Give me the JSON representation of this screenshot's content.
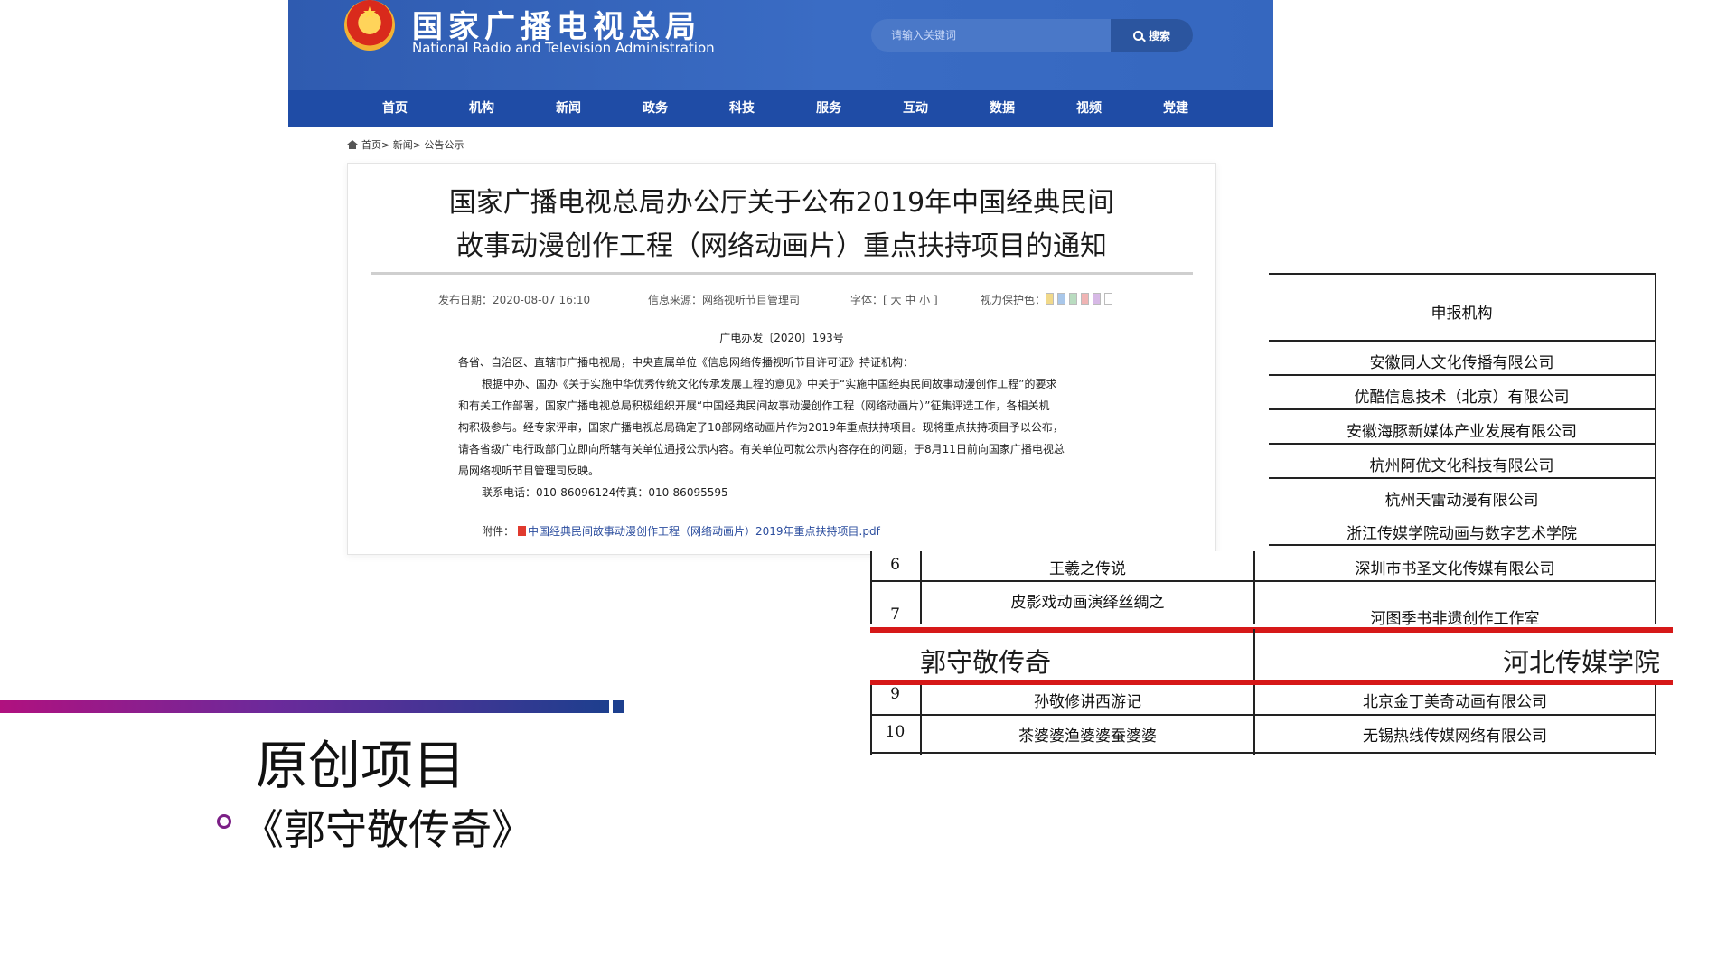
{
  "site": {
    "title_cn": "国家广播电视总局",
    "title_en": "National Radio and Television Administration",
    "search_placeholder": "请输入关键词",
    "search_button": "搜索"
  },
  "nav": [
    "首页",
    "机构",
    "新闻",
    "政务",
    "科技",
    "服务",
    "互动",
    "数据",
    "视频",
    "党建"
  ],
  "breadcrumb": "首页> 新闻> 公告公示",
  "article": {
    "title_line1": "国家广播电视总局办公厅关于公布2019年中国经典民间",
    "title_line2": "故事动漫创作工程（网络动画片）重点扶持项目的通知",
    "publish_date": "发布日期：2020-08-07 16:10",
    "source": "信息来源：网络视听节目管理司",
    "font_size": "字体：[ 大 中 小 ]",
    "eye_protect": "视力保护色：",
    "swatch_colors": [
      "#f1d98a",
      "#a9c7ea",
      "#b9dcc0",
      "#f0b4b4",
      "#d7b9e6",
      "#ffffff"
    ],
    "doc_number": "广电办发〔2020〕193号",
    "recipients": "各省、自治区、直辖市广播电视局，中央直属单位《信息网络传播视听节目许可证》持证机构：",
    "body_lines": [
      "根据中办、国办《关于实施中华优秀传统文化传承发展工程的意见》中关于“实施中国经典民间故事动漫创作工程”的要求",
      "和有关工作部署，国家广播电视总局积极组织开展“中国经典民间故事动漫创作工程（网络动画片）”征集评选工作，各相关机",
      "构积极参与。经专家评审，国家广播电视总局确定了10部网络动画片作为2019年重点扶持项目。现将重点扶持项目予以公布，",
      "请各省级广电行政部门立即向所辖有关单位通报公示内容。有关单位可就公示内容存在的问题，于8月11日前向国家广播电视总",
      "局网络视听节目管理司反映。"
    ],
    "contact": "联系电话：010-86096124传真：010-86095595",
    "attachment_label": "附件：",
    "attachment_link": "中国经典民间故事动漫创作工程（网络动画片）2019年重点扶持项目.pdf"
  },
  "table": {
    "header_org": "申报机构",
    "upper_orgs": [
      "安徽同人文化传播有限公司",
      "优酷信息技术（北京）有限公司",
      "安徽海豚新媒体产业发展有限公司",
      "杭州阿优文化科技有限公司",
      "杭州天雷动漫有限公司",
      "浙江传媒学院动画与数字艺术学院"
    ],
    "rows": [
      {
        "num": "6",
        "title": "王羲之传说",
        "org": "深圳市书圣文化传媒有限公司"
      },
      {
        "num": "7",
        "title": "皮影戏动画演绎丝绸之",
        "org": "河图季书非遗创作工作室"
      },
      {
        "num": "",
        "title": "郭守敬传奇",
        "org": "河北传媒学院"
      },
      {
        "num": "9",
        "title": "孙敬修讲西游记",
        "org": "北京金丁美奇动画有限公司"
      },
      {
        "num": "10",
        "title": "茶婆婆渔婆婆蚕婆婆",
        "org": "无锡热线传媒网络有限公司"
      }
    ],
    "highlight_color": "#d61818"
  },
  "slide": {
    "heading": "原创项目",
    "item": "《郭守敬传奇》",
    "accent_colors": [
      "#b0117f",
      "#6b2a9b",
      "#1d3f8e"
    ]
  }
}
